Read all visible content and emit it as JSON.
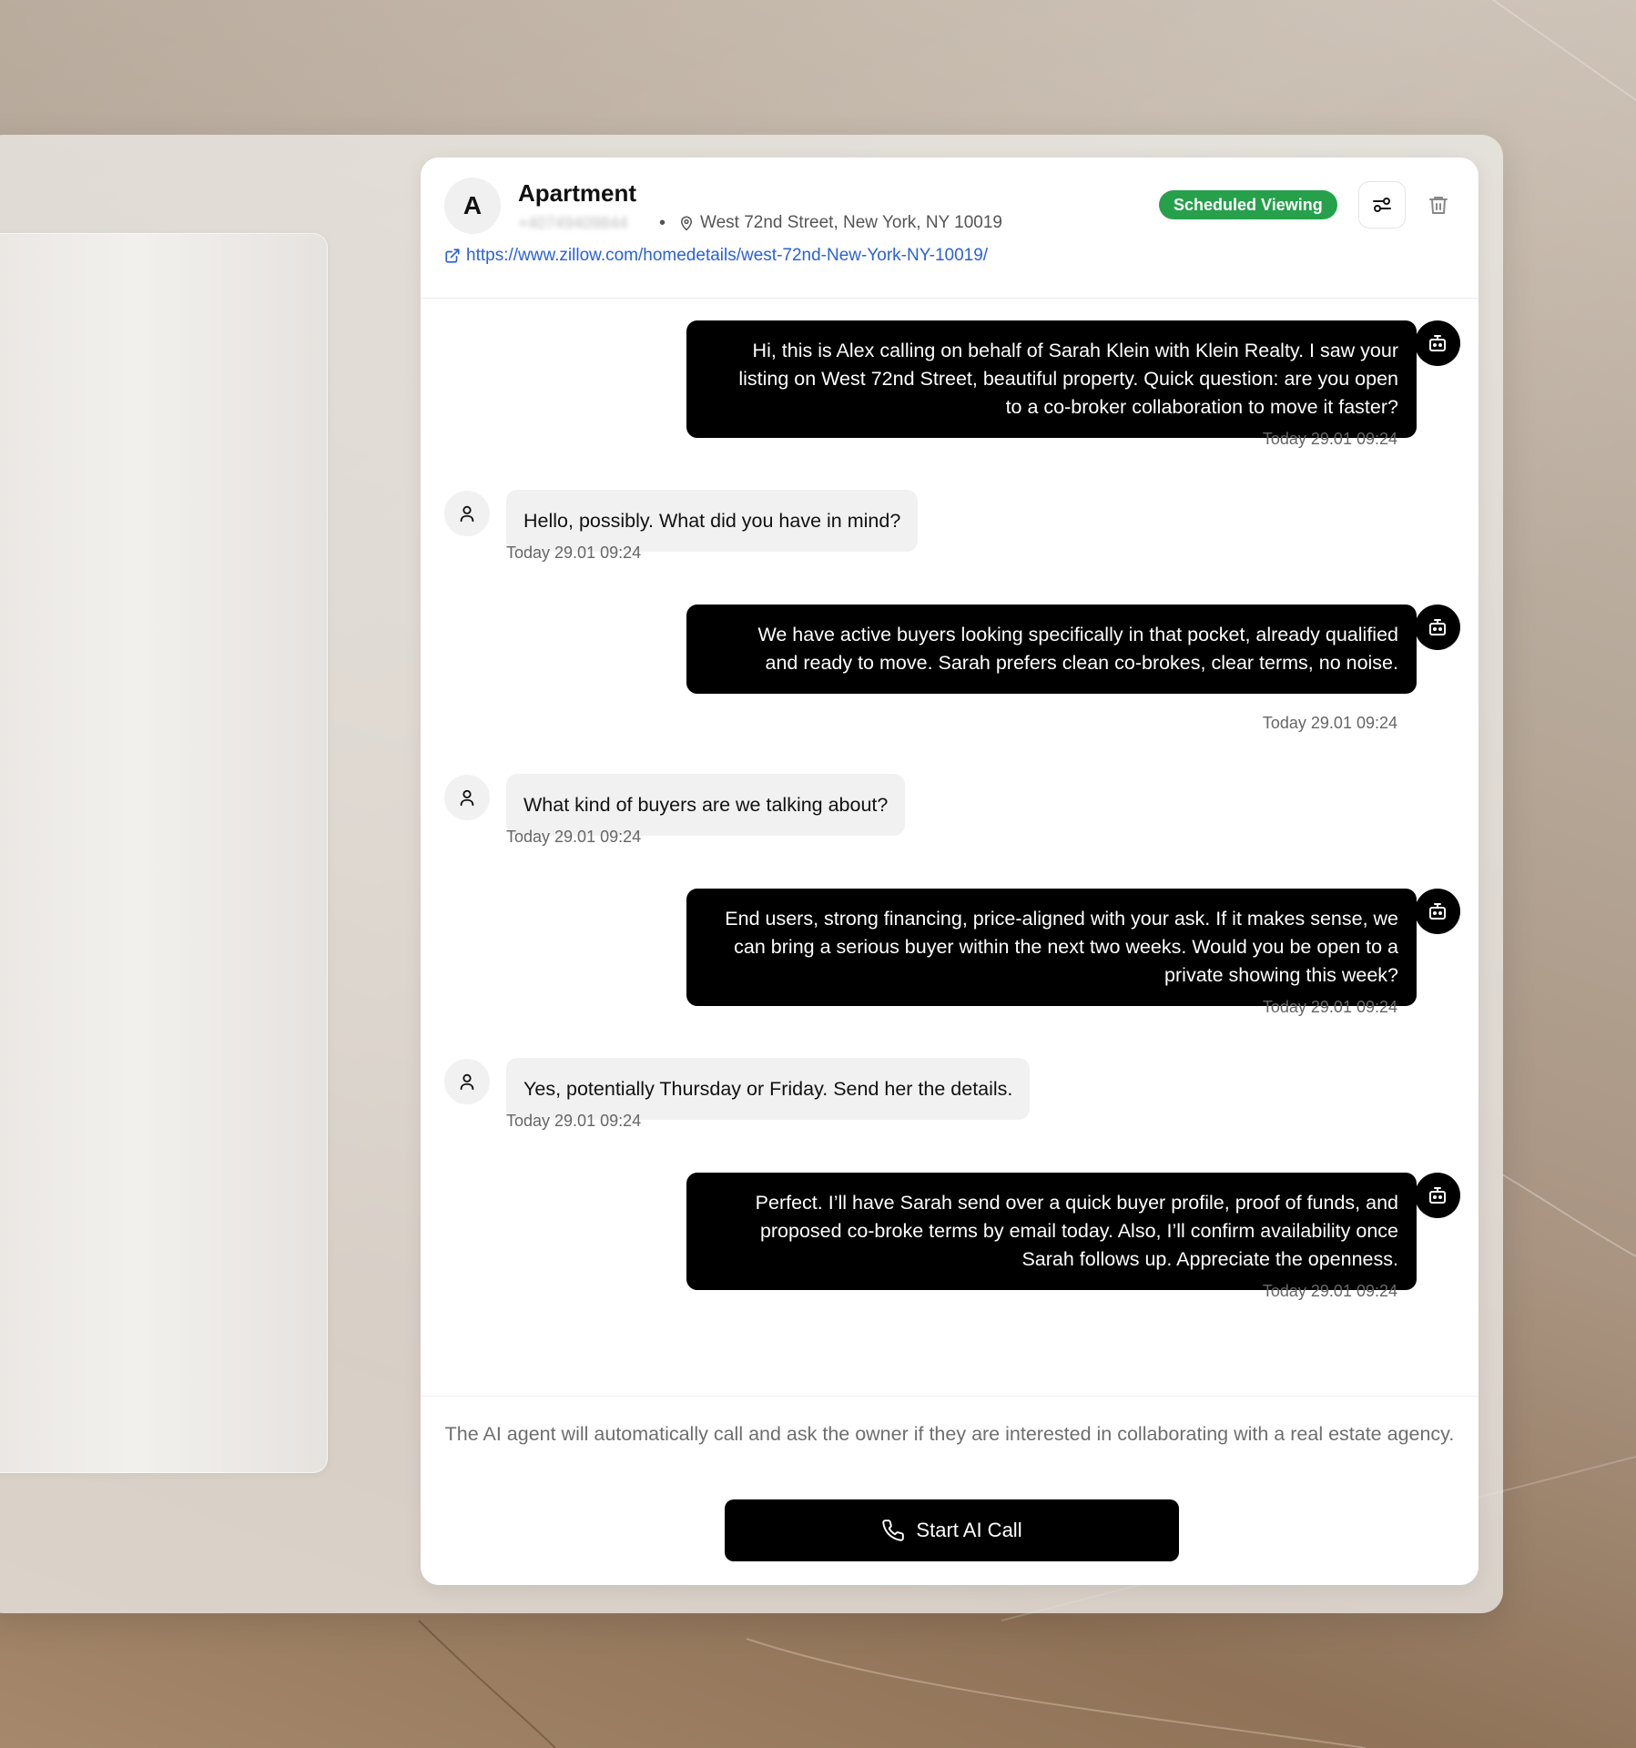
{
  "listing": {
    "avatar_letter": "A",
    "title": "Apartment",
    "phone": "+40749409844",
    "separator": "•",
    "address": "West 72nd Street, New York, NY 10019",
    "url": "https://www.zillow.com/homedetails/west-72nd-New-York-NY-10019/",
    "status": "Scheduled Viewing",
    "status_color": "#26a04b"
  },
  "messages": [
    {
      "role": "agent",
      "text": "Hi, this is Alex calling on behalf of Sarah Klein with Klein Realty. I saw your listing on West 72nd Street, beautiful property. Quick question: are you open to a co-broker collaboration to move it faster?",
      "time": "Today 29.01 09:24"
    },
    {
      "role": "owner",
      "text": "Hello, possibly. What did you have in mind?",
      "time": "Today 29.01 09:24"
    },
    {
      "role": "agent",
      "text": "We have active buyers looking specifically in that pocket, already qualified and ready to move. Sarah prefers clean co-brokes, clear terms, no noise.",
      "time": "Today 29.01 09:24"
    },
    {
      "role": "owner",
      "text": "What kind of buyers are we talking about?",
      "time": "Today 29.01 09:24"
    },
    {
      "role": "agent",
      "text": "End users, strong financing, price-aligned with your ask. If it makes sense, we can bring a serious buyer within the next two weeks. Would you be open to a private showing this week?",
      "time": "Today 29.01 09:24"
    },
    {
      "role": "owner",
      "text": "Yes, potentially Thursday or Friday. Send her the details.",
      "time": "Today 29.01 09:24"
    },
    {
      "role": "agent",
      "text": "Perfect. I’ll have Sarah send over a quick buyer profile, proof of funds, and proposed co-broke terms by email today. Also, I’ll confirm availability once Sarah follows up. Appreciate the openness.",
      "time": "Today 29.01 09:24"
    }
  ],
  "footer": {
    "note": "The AI agent will automatically call and ask the owner if they are interested in collaborating with a real estate agency.",
    "call_button_label": "Start AI Call"
  },
  "icons": {
    "agent": "robot-icon",
    "owner": "user-icon",
    "address": "map-pin-icon",
    "link": "external-link-icon",
    "settings": "sliders-icon",
    "delete": "trash-icon",
    "call": "phone-icon"
  }
}
